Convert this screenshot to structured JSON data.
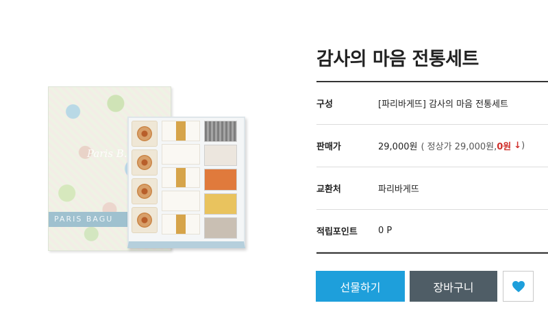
{
  "product": {
    "title": "감사의 마음 전통세트",
    "image_alt": "Paris Baguette traditional gift set box",
    "box_text": "PARIS BAGU",
    "box_script": "Paris B."
  },
  "info": [
    {
      "label": "구성",
      "value": "[파리바게뜨] 감사의 마음 전통세트"
    },
    {
      "label": "판매가",
      "price": "29,000원",
      "paren_open": "( 정상가 29,000원, ",
      "discount": "0원",
      "arrow": "↓",
      "paren_close": " )"
    },
    {
      "label": "교환처",
      "value": "파리바게뜨"
    },
    {
      "label": "적립포인트",
      "value": "0 P"
    }
  ],
  "buttons": {
    "gift": "선물하기",
    "cart": "장바구니",
    "like_icon": "heart-icon"
  },
  "colors": {
    "gift_button": "#1e9fdb",
    "cart_button": "#4f5d66",
    "heart": "#1e9fdb",
    "discount": "#d0312d"
  }
}
